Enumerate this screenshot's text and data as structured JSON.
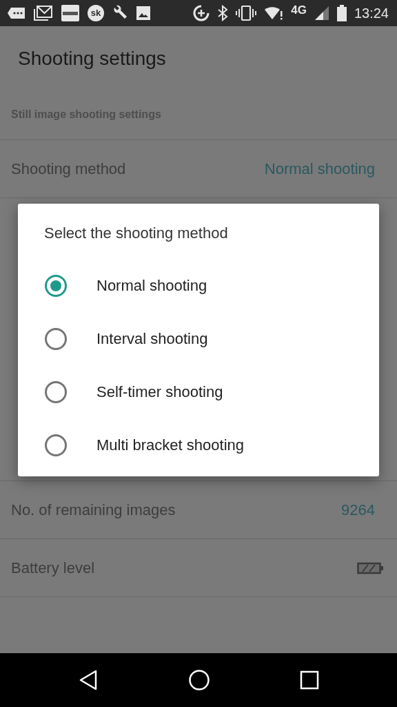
{
  "status_bar": {
    "app_badge": "sk",
    "network": "4G",
    "time": "13:24"
  },
  "app_bar": {
    "title": "Shooting settings"
  },
  "section_header": "Still image shooting settings",
  "settings_top": [
    {
      "kind": "text",
      "label": "Shooting method",
      "value": "Normal shooting"
    }
  ],
  "settings_bottom": [
    {
      "kind": "text",
      "label": "No. of remaining images",
      "value": "9264"
    },
    {
      "kind": "battery",
      "label": "Battery level"
    }
  ],
  "dialog": {
    "title": "Select the shooting method",
    "options": [
      {
        "label": "Normal shooting",
        "selected": true
      },
      {
        "label": "Interval shooting",
        "selected": false
      },
      {
        "label": "Self-timer shooting",
        "selected": false
      },
      {
        "label": "Multi bracket shooting",
        "selected": false
      }
    ]
  }
}
